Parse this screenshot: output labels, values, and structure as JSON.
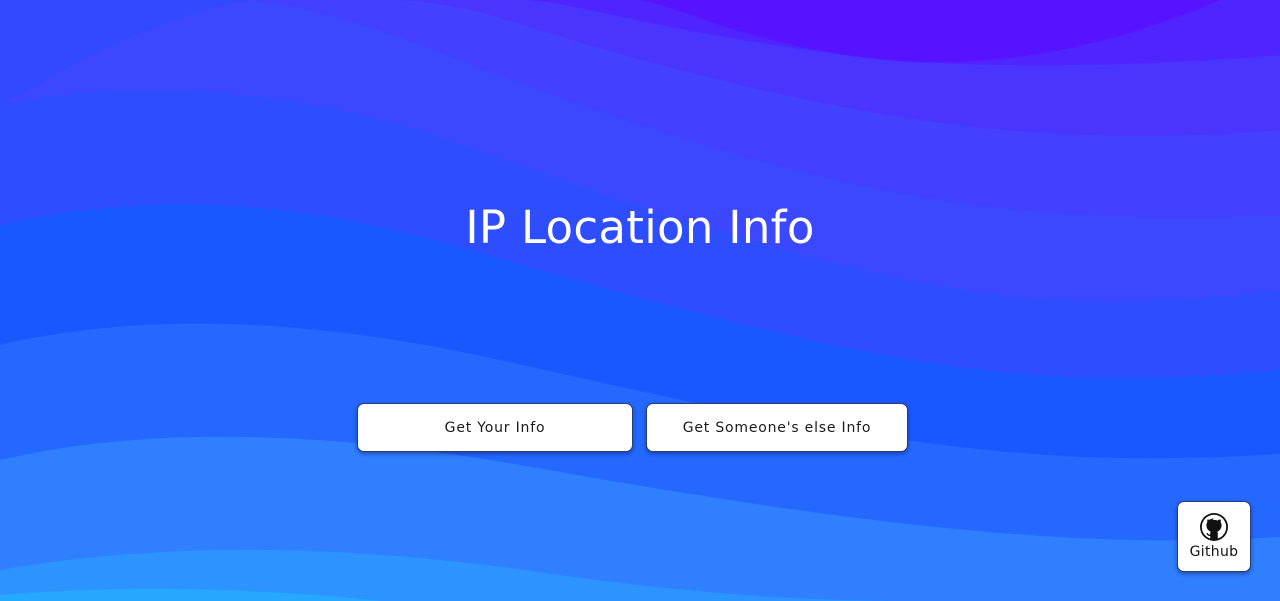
{
  "page": {
    "title": "IP Location Info"
  },
  "actions": {
    "get_your_info": "Get Your Info",
    "get_someone_info": "Get Someone's else Info"
  },
  "github": {
    "label": "Github",
    "icon": "github-icon"
  },
  "colors": {
    "wave_top": "#5512ff",
    "wave_mid": "#1457ff",
    "wave_bottom": "#25a6ff",
    "button_bg": "#ffffff",
    "title_text": "#ffffff"
  }
}
